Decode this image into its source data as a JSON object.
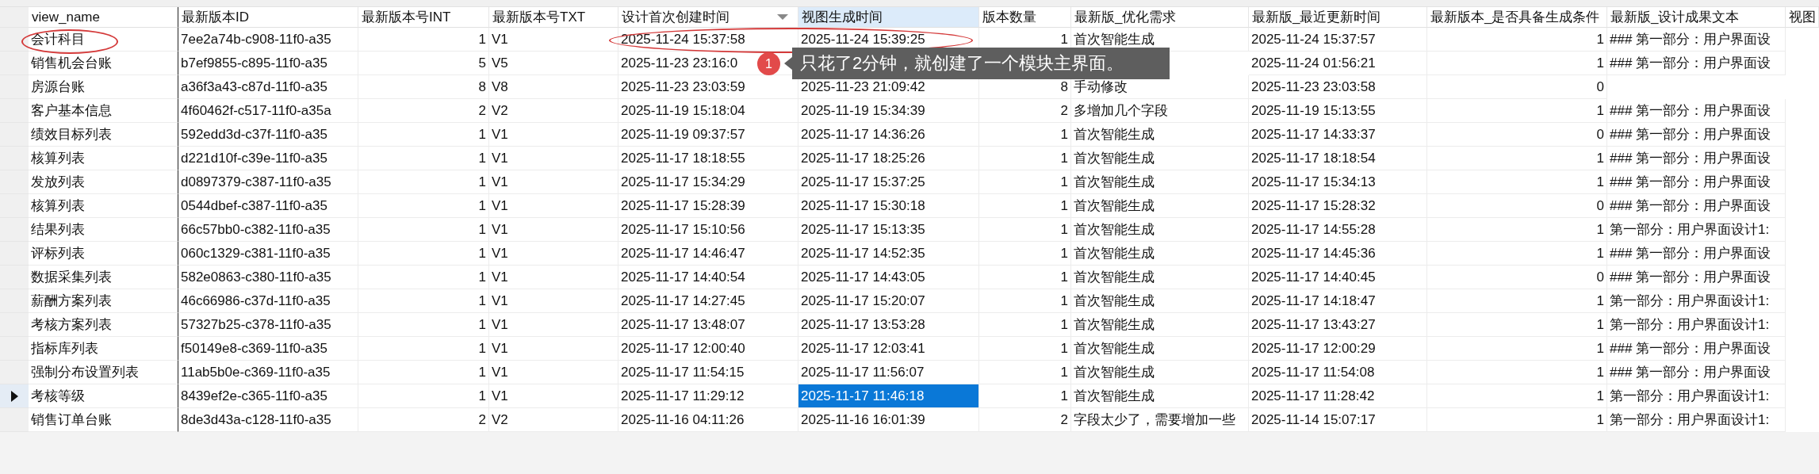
{
  "table": {
    "columns": [
      {
        "label": "view_name",
        "kind": "text",
        "sorted": false,
        "focused": false
      },
      {
        "label": "最新版本ID",
        "kind": "text",
        "sorted": false,
        "focused": false
      },
      {
        "label": "最新版本号INT",
        "kind": "number",
        "sorted": false,
        "focused": false
      },
      {
        "label": "最新版本号TXT",
        "kind": "text",
        "sorted": false,
        "focused": false
      },
      {
        "label": "设计首次创建时间",
        "kind": "text",
        "sorted": true,
        "focused": false
      },
      {
        "label": "视图生成时间",
        "kind": "text",
        "sorted": false,
        "focused": true
      },
      {
        "label": "版本数量",
        "kind": "number",
        "sorted": false,
        "focused": false
      },
      {
        "label": "最新版_优化需求",
        "kind": "text",
        "sorted": false,
        "focused": false
      },
      {
        "label": "最新版_最近更新时间",
        "kind": "text",
        "sorted": false,
        "focused": false
      },
      {
        "label": "最新版本_是否具备生成条件",
        "kind": "number",
        "sorted": false,
        "focused": false
      },
      {
        "label": "最新版_设计成果文本",
        "kind": "text",
        "sorted": false,
        "focused": false
      },
      {
        "label": "视图",
        "kind": "text",
        "sorted": false,
        "focused": false
      }
    ],
    "rows": [
      {
        "selected": false,
        "cells": [
          "会计科目",
          "7ee2a74b-c908-11f0-a35",
          "1",
          "V1",
          "2025-11-24 15:37:58",
          "2025-11-24 15:39:25",
          "1",
          "首次智能生成",
          "2025-11-24 15:37:57",
          "1",
          "### 第一部分：用户界面设"
        ]
      },
      {
        "selected": false,
        "cells": [
          "销售机会台账",
          "b7ef9855-c895-11f0-a35",
          "5",
          "V5",
          "2025-11-23 23:16:0",
          null,
          null,
          null,
          "2025-11-24 01:56:21",
          "1",
          "### 第一部分：用户界面设"
        ]
      },
      {
        "selected": false,
        "cells": [
          "房源台账",
          "a36f3a43-c87d-11f0-a35",
          "8",
          "V8",
          "2025-11-23 23:03:59",
          "2025-11-23 21:09:42",
          "8",
          "手动修改",
          "2025-11-23 23:03:58",
          "0",
          null
        ]
      },
      {
        "selected": false,
        "cells": [
          "客户基本信息",
          "4f60462f-c517-11f0-a35a",
          "2",
          "V2",
          "2025-11-19 15:18:04",
          "2025-11-19 15:34:39",
          "2",
          "多增加几个字段",
          "2025-11-19 15:13:55",
          "1",
          "### 第一部分：用户界面设"
        ]
      },
      {
        "selected": false,
        "cells": [
          "绩效目标列表",
          "592edd3d-c37f-11f0-a35",
          "1",
          "V1",
          "2025-11-19 09:37:57",
          "2025-11-17 14:36:26",
          "1",
          "首次智能生成",
          "2025-11-17 14:33:37",
          "0",
          "### 第一部分：用户界面设"
        ]
      },
      {
        "selected": false,
        "cells": [
          "核算列表",
          "d221d10f-c39e-11f0-a35",
          "1",
          "V1",
          "2025-11-17 18:18:55",
          "2025-11-17 18:25:26",
          "1",
          "首次智能生成",
          "2025-11-17 18:18:54",
          "1",
          "### 第一部分：用户界面设"
        ]
      },
      {
        "selected": false,
        "cells": [
          "发放列表",
          "d0897379-c387-11f0-a35",
          "1",
          "V1",
          "2025-11-17 15:34:29",
          "2025-11-17 15:37:25",
          "1",
          "首次智能生成",
          "2025-11-17 15:34:13",
          "1",
          "### 第一部分：用户界面设"
        ]
      },
      {
        "selected": false,
        "cells": [
          "核算列表",
          "0544dbef-c387-11f0-a35",
          "1",
          "V1",
          "2025-11-17 15:28:39",
          "2025-11-17 15:30:18",
          "1",
          "首次智能生成",
          "2025-11-17 15:28:32",
          "0",
          "### 第一部分：用户界面设"
        ]
      },
      {
        "selected": false,
        "cells": [
          "结果列表",
          "66c57bb0-c382-11f0-a35",
          "1",
          "V1",
          "2025-11-17 15:10:56",
          "2025-11-17 15:13:35",
          "1",
          "首次智能生成",
          "2025-11-17 14:55:28",
          "1",
          "第一部分：用户界面设计1:"
        ]
      },
      {
        "selected": false,
        "cells": [
          "评标列表",
          "060c1329-c381-11f0-a35",
          "1",
          "V1",
          "2025-11-17 14:46:47",
          "2025-11-17 14:52:35",
          "1",
          "首次智能生成",
          "2025-11-17 14:45:36",
          "1",
          "### 第一部分：用户界面设"
        ]
      },
      {
        "selected": false,
        "cells": [
          "数据采集列表",
          "582e0863-c380-11f0-a35",
          "1",
          "V1",
          "2025-11-17 14:40:54",
          "2025-11-17 14:43:05",
          "1",
          "首次智能生成",
          "2025-11-17 14:40:45",
          "0",
          "### 第一部分：用户界面设"
        ]
      },
      {
        "selected": false,
        "cells": [
          "薪酬方案列表",
          "46c66986-c37d-11f0-a35",
          "1",
          "V1",
          "2025-11-17 14:27:45",
          "2025-11-17 15:20:07",
          "1",
          "首次智能生成",
          "2025-11-17 14:18:47",
          "1",
          "第一部分：用户界面设计1:"
        ]
      },
      {
        "selected": false,
        "cells": [
          "考核方案列表",
          "57327b25-c378-11f0-a35",
          "1",
          "V1",
          "2025-11-17 13:48:07",
          "2025-11-17 13:53:28",
          "1",
          "首次智能生成",
          "2025-11-17 13:43:27",
          "1",
          "第一部分：用户界面设计1:"
        ]
      },
      {
        "selected": false,
        "cells": [
          "指标库列表",
          "f50149e8-c369-11f0-a35",
          "1",
          "V1",
          "2025-11-17 12:00:40",
          "2025-11-17 12:03:41",
          "1",
          "首次智能生成",
          "2025-11-17 12:00:29",
          "1",
          "### 第一部分：用户界面设"
        ]
      },
      {
        "selected": false,
        "cells": [
          "强制分布设置列表",
          "11ab5b0e-c369-11f0-a35",
          "1",
          "V1",
          "2025-11-17 11:54:15",
          "2025-11-17 11:56:07",
          "1",
          "首次智能生成",
          "2025-11-17 11:54:08",
          "1",
          "### 第一部分：用户界面设"
        ]
      },
      {
        "selected": true,
        "cells": [
          "考核等级",
          "8439ef2e-c365-11f0-a35",
          "1",
          "V1",
          "2025-11-17 11:29:12",
          "2025-11-17 11:46:18",
          "1",
          "首次智能生成",
          "2025-11-17 11:28:42",
          "1",
          "第一部分：用户界面设计1:"
        ]
      },
      {
        "selected": false,
        "cells": [
          "销售订单台账",
          "8de3d43a-c128-11f0-a35",
          "2",
          "V2",
          "2025-11-16 04:11:26",
          "2025-11-16 16:01:39",
          "2",
          "字段太少了，需要增加一些",
          "2025-11-14 15:07:17",
          "1",
          "第一部分：用户界面设计1:"
        ]
      }
    ]
  },
  "annotation": {
    "badge": "1",
    "note": "只花了2分钟，就创建了一个模块主界面。"
  }
}
